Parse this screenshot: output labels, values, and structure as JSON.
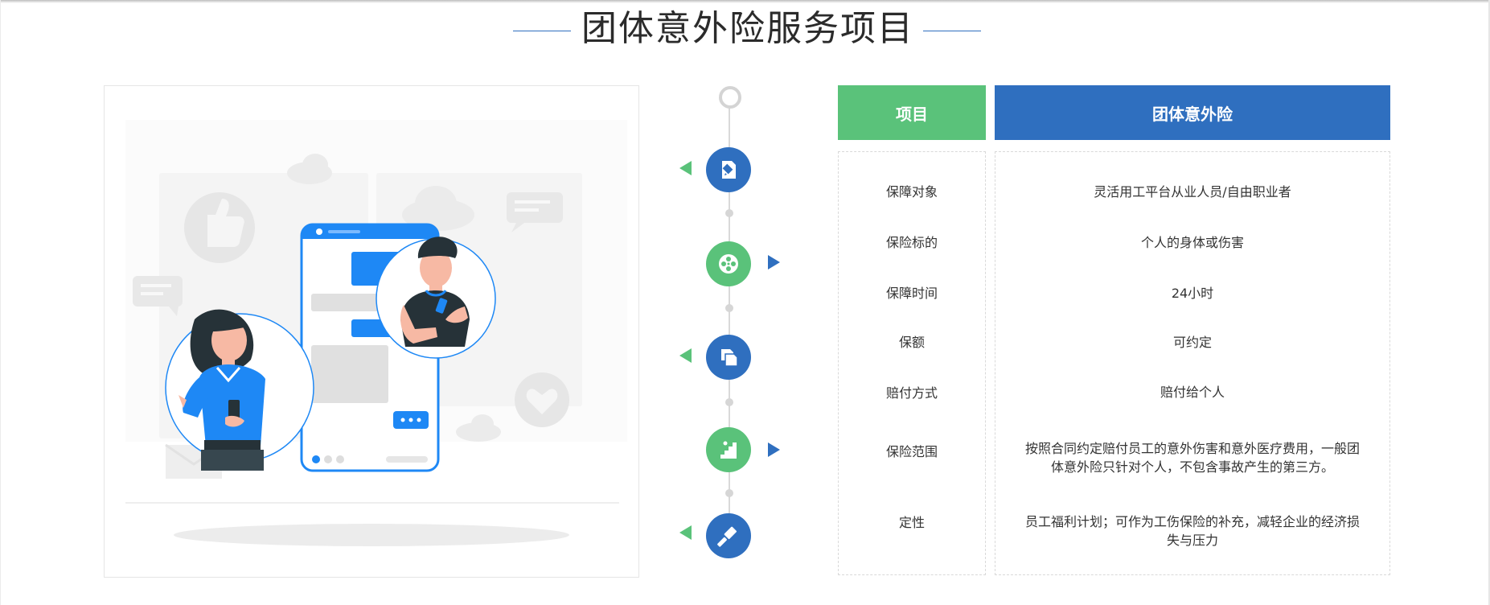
{
  "page": {
    "title": "团体意外险服务项目"
  },
  "table": {
    "header_col1": "项目",
    "header_col2": "团体意外险",
    "rows": [
      {
        "label": "保障对象",
        "value": "灵活用工平台从业人员/自由职业者"
      },
      {
        "label": "保险标的",
        "value": "个人的身体或伤害"
      },
      {
        "label": "保障时间",
        "value": "24小时"
      },
      {
        "label": "保额",
        "value": "可约定"
      },
      {
        "label": "赔付方式",
        "value": "赔付给个人"
      },
      {
        "label": "保险范围",
        "value": "按照合同约定赔付员工的意外伤害和意外医疗费用，一般团体意外险只针对个人，不包含事故产生的第三方。"
      },
      {
        "label": "定性",
        "value": "员工福利计划；可作为工伤保险的补充，减轻企业的经济损失与压力"
      }
    ]
  },
  "timeline": {
    "nodes": [
      {
        "icon": "document-edit-icon",
        "color": "#2f6fbf",
        "arrow": "left"
      },
      {
        "icon": "film-reel-icon",
        "color": "#5ac27a",
        "arrow": "right"
      },
      {
        "icon": "documents-icon",
        "color": "#2f6fbf",
        "arrow": "left"
      },
      {
        "icon": "stairs-icon",
        "color": "#5ac27a",
        "arrow": "right"
      },
      {
        "icon": "gavel-icon",
        "color": "#2f6fbf",
        "arrow": "left"
      }
    ]
  },
  "colors": {
    "accent_blue": "#2f6fbf",
    "accent_green": "#5ac27a",
    "phone_blue": "#1e88f5"
  },
  "illustration": {
    "icon": "chat-app-illustration"
  }
}
